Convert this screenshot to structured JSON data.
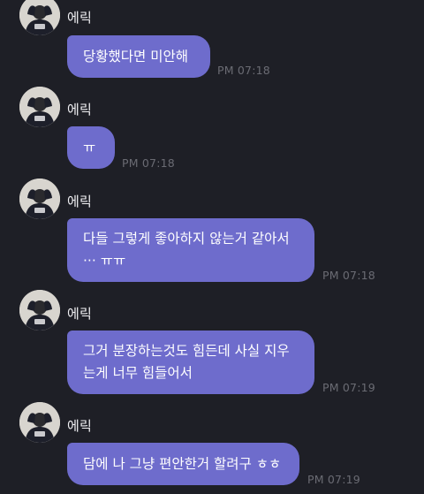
{
  "sender": "에릭",
  "messages": [
    {
      "text": "당황했다면 미안해",
      "time": "PM 07:18"
    },
    {
      "text": "ㅠ",
      "time": "PM 07:18"
    },
    {
      "text": "다들 그렇게 좋아하지 않는거 같아서\n··· ㅠㅠ",
      "time": "PM 07:18"
    },
    {
      "text": "그거 분장하는것도 힘든데 사실 지우\n는게 너무 힘들어서",
      "time": "PM 07:19"
    },
    {
      "text": "담에 나 그냥 편안한거 할려구 ㅎㅎ",
      "time": "PM 07:19"
    }
  ]
}
